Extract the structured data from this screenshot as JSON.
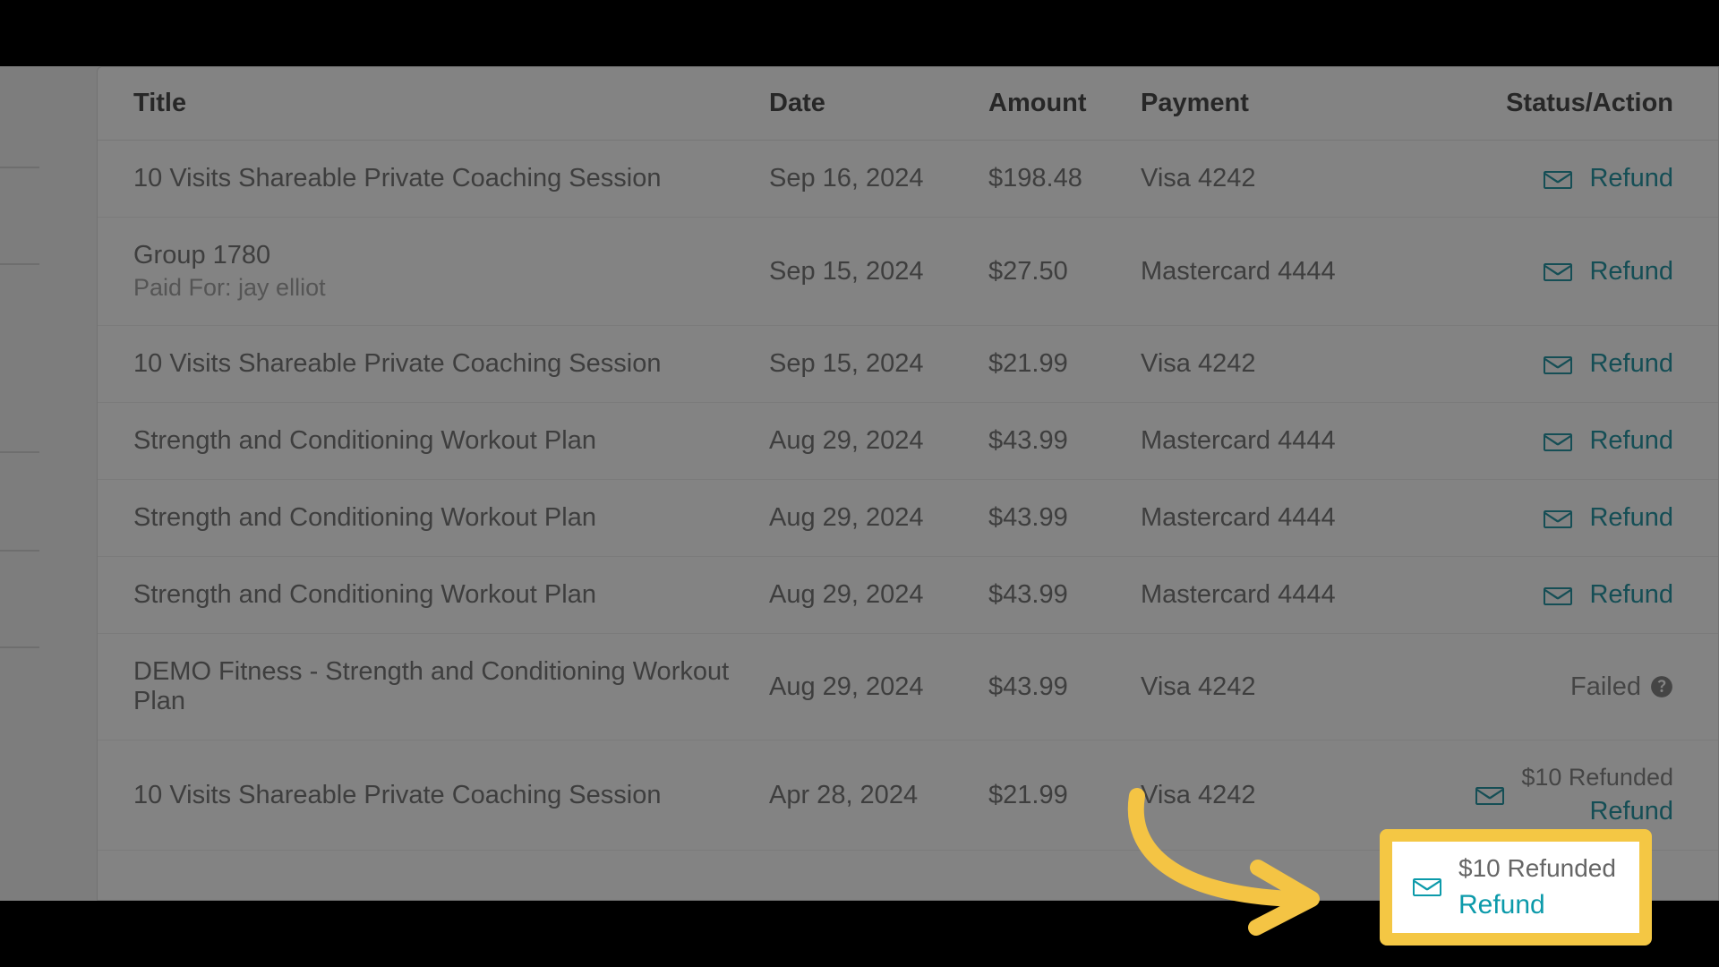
{
  "table": {
    "headers": {
      "title": "Title",
      "date": "Date",
      "amount": "Amount",
      "payment": "Payment",
      "status": "Status/Action"
    },
    "rows": [
      {
        "title": "10 Visits Shareable Private Coaching Session",
        "subtitle": "",
        "date": "Sep 16, 2024",
        "amount": "$198.48",
        "payment": "Visa 4242",
        "status_type": "refund",
        "refund_label": "Refund"
      },
      {
        "title": "Group 1780",
        "subtitle": "Paid For: jay elliot",
        "date": "Sep 15, 2024",
        "amount": "$27.50",
        "payment": "Mastercard 4444",
        "status_type": "refund",
        "refund_label": "Refund"
      },
      {
        "title": "10 Visits Shareable Private Coaching Session",
        "subtitle": "",
        "date": "Sep 15, 2024",
        "amount": "$21.99",
        "payment": "Visa 4242",
        "status_type": "refund",
        "refund_label": "Refund"
      },
      {
        "title": "Strength and Conditioning Workout Plan",
        "subtitle": "",
        "date": "Aug 29, 2024",
        "amount": "$43.99",
        "payment": "Mastercard 4444",
        "status_type": "refund",
        "refund_label": "Refund"
      },
      {
        "title": "Strength and Conditioning Workout Plan",
        "subtitle": "",
        "date": "Aug 29, 2024",
        "amount": "$43.99",
        "payment": "Mastercard 4444",
        "status_type": "refund",
        "refund_label": "Refund"
      },
      {
        "title": "Strength and Conditioning Workout Plan",
        "subtitle": "",
        "date": "Aug 29, 2024",
        "amount": "$43.99",
        "payment": "Mastercard 4444",
        "status_type": "refund",
        "refund_label": "Refund"
      },
      {
        "title": "DEMO Fitness - Strength and Conditioning Workout Plan",
        "subtitle": "",
        "date": "Aug 29, 2024",
        "amount": "$43.99",
        "payment": "Visa 4242",
        "status_type": "failed",
        "failed_label": "Failed"
      },
      {
        "title": "10 Visits Shareable Private Coaching Session",
        "subtitle": "",
        "date": "Apr 28, 2024",
        "amount": "$21.99",
        "payment": "Visa 4242",
        "status_type": "partial_refund",
        "refunded_note": "$10 Refunded",
        "refund_label": "Refund"
      }
    ]
  },
  "highlight": {
    "refunded_note": "$10 Refunded",
    "refund_label": "Refund"
  },
  "colors": {
    "link": "#0c8a9a",
    "highlight_border": "#f4c744",
    "arrow": "#f4c444"
  }
}
